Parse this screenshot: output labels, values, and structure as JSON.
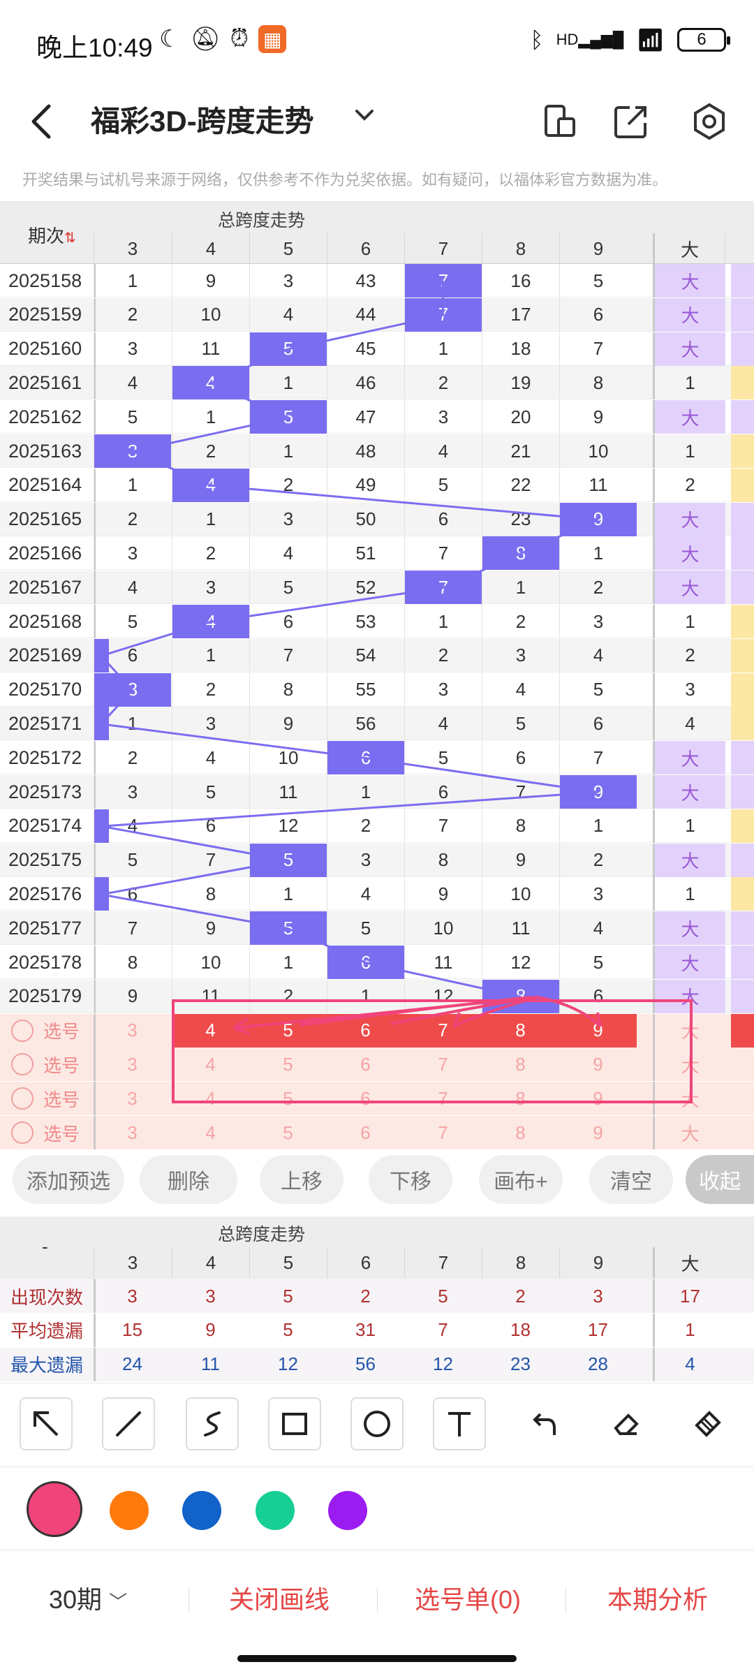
{
  "status": {
    "time": "晚上10:49",
    "battery": "6",
    "network": "HD"
  },
  "header": {
    "title": "福彩3D-跨度走势"
  },
  "notice": "开奖结果与试机号来源于网络，仅供参考不作为兑奖依据。如有疑问，以福体彩官方数据为准。",
  "table": {
    "period_header": "期次",
    "group_title": "总跨度走势",
    "columns": [
      "3",
      "4",
      "5",
      "6",
      "7",
      "8",
      "9"
    ],
    "size_header": "大",
    "rows": [
      {
        "period": "2025158",
        "vals": [
          "1",
          "9",
          "3",
          "43",
          "7",
          "16",
          "5"
        ],
        "hit": 4,
        "size": "大"
      },
      {
        "period": "2025159",
        "vals": [
          "2",
          "10",
          "4",
          "44",
          "7",
          "17",
          "6"
        ],
        "hit": 4,
        "size": "大"
      },
      {
        "period": "2025160",
        "vals": [
          "3",
          "11",
          "5",
          "45",
          "1",
          "18",
          "7"
        ],
        "hit": 2,
        "size": "大"
      },
      {
        "period": "2025161",
        "vals": [
          "4",
          "4",
          "1",
          "46",
          "2",
          "19",
          "8"
        ],
        "hit": 1,
        "size": "1"
      },
      {
        "period": "2025162",
        "vals": [
          "5",
          "1",
          "5",
          "47",
          "3",
          "20",
          "9"
        ],
        "hit": 2,
        "size": "大"
      },
      {
        "period": "2025163",
        "vals": [
          "3",
          "2",
          "1",
          "48",
          "4",
          "21",
          "10"
        ],
        "hit": 0,
        "size": "1"
      },
      {
        "period": "2025164",
        "vals": [
          "1",
          "4",
          "2",
          "49",
          "5",
          "22",
          "11"
        ],
        "hit": 1,
        "size": "2"
      },
      {
        "period": "2025165",
        "vals": [
          "2",
          "1",
          "3",
          "50",
          "6",
          "23",
          "9"
        ],
        "hit": 6,
        "size": "大"
      },
      {
        "period": "2025166",
        "vals": [
          "3",
          "2",
          "4",
          "51",
          "7",
          "8",
          "1"
        ],
        "hit": 5,
        "size": "大"
      },
      {
        "period": "2025167",
        "vals": [
          "4",
          "3",
          "5",
          "52",
          "7",
          "1",
          "2"
        ],
        "hit": 4,
        "size": "大"
      },
      {
        "period": "2025168",
        "vals": [
          "5",
          "4",
          "6",
          "53",
          "1",
          "2",
          "3"
        ],
        "hit": 1,
        "size": "1"
      },
      {
        "period": "2025169",
        "vals": [
          "6",
          "1",
          "7",
          "54",
          "2",
          "3",
          "4"
        ],
        "hit": -1,
        "size": "2"
      },
      {
        "period": "2025170",
        "vals": [
          "3",
          "2",
          "8",
          "55",
          "3",
          "4",
          "5"
        ],
        "hit": 0,
        "size": "3"
      },
      {
        "period": "2025171",
        "vals": [
          "1",
          "3",
          "9",
          "56",
          "4",
          "5",
          "6"
        ],
        "hit": -1,
        "size": "4"
      },
      {
        "period": "2025172",
        "vals": [
          "2",
          "4",
          "10",
          "6",
          "5",
          "6",
          "7"
        ],
        "hit": 3,
        "size": "大"
      },
      {
        "period": "2025173",
        "vals": [
          "3",
          "5",
          "11",
          "1",
          "6",
          "7",
          "9"
        ],
        "hit": 6,
        "size": "大"
      },
      {
        "period": "2025174",
        "vals": [
          "4",
          "6",
          "12",
          "2",
          "7",
          "8",
          "1"
        ],
        "hit": -1,
        "size": "1"
      },
      {
        "period": "2025175",
        "vals": [
          "5",
          "7",
          "5",
          "3",
          "8",
          "9",
          "2"
        ],
        "hit": 2,
        "size": "大"
      },
      {
        "period": "2025176",
        "vals": [
          "6",
          "8",
          "1",
          "4",
          "9",
          "10",
          "3"
        ],
        "hit": -1,
        "size": "1"
      },
      {
        "period": "2025177",
        "vals": [
          "7",
          "9",
          "5",
          "5",
          "10",
          "11",
          "4"
        ],
        "hit": 2,
        "size": "大"
      },
      {
        "period": "2025178",
        "vals": [
          "8",
          "10",
          "1",
          "6",
          "11",
          "12",
          "5"
        ],
        "hit": 3,
        "size": "大"
      },
      {
        "period": "2025179",
        "vals": [
          "9",
          "11",
          "2",
          "1",
          "12",
          "8",
          "6"
        ],
        "hit": 5,
        "size": "大"
      }
    ],
    "pick_label": "选号",
    "pick_rows": [
      {
        "vals": [
          "3",
          "4",
          "5",
          "6",
          "7",
          "8",
          "9"
        ],
        "size": "大",
        "highlight": true
      },
      {
        "vals": [
          "3",
          "4",
          "5",
          "6",
          "7",
          "8",
          "9"
        ],
        "size": "大",
        "highlight": false
      },
      {
        "vals": [
          "3",
          "4",
          "5",
          "6",
          "7",
          "8",
          "9"
        ],
        "size": "大",
        "highlight": false
      },
      {
        "vals": [
          "3",
          "4",
          "5",
          "6",
          "7",
          "8",
          "9"
        ],
        "size": "大",
        "highlight": false
      }
    ]
  },
  "actions": [
    "添加预选",
    "删除",
    "上移",
    "下移",
    "画布+",
    "清空",
    "收起"
  ],
  "stats": {
    "corner": "-",
    "group_title": "总跨度走势",
    "columns": [
      "3",
      "4",
      "5",
      "6",
      "7",
      "8",
      "9"
    ],
    "size_header": "大",
    "rows": [
      {
        "label": "出现次数",
        "vals": [
          "3",
          "3",
          "5",
          "2",
          "5",
          "2",
          "3"
        ],
        "size": "17",
        "color": "#b03030"
      },
      {
        "label": "平均遗漏",
        "vals": [
          "15",
          "9",
          "5",
          "31",
          "7",
          "18",
          "17"
        ],
        "size": "1",
        "color": "#b03030"
      },
      {
        "label": "最大遗漏",
        "vals": [
          "24",
          "11",
          "12",
          "56",
          "12",
          "23",
          "28"
        ],
        "size": "4",
        "color": "#2255aa"
      }
    ]
  },
  "tools": [
    "arrow-icon",
    "line-icon",
    "freehand-icon",
    "rectangle-icon",
    "circle-icon",
    "text-icon",
    "undo-icon",
    "eraser-icon",
    "clear-icon"
  ],
  "colors": [
    "#f0457a",
    "#ff7a0a",
    "#1162c9",
    "#17cf95",
    "#9b1cf0"
  ],
  "bottom": {
    "period": "30期",
    "close_lines": "关闭画线",
    "pick_list": "选号单(0)",
    "analysis": "本期分析"
  }
}
